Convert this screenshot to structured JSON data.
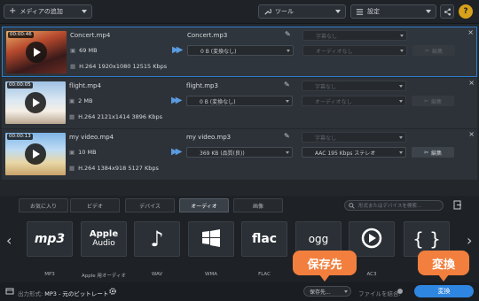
{
  "toolbar": {
    "add_media_label": "メディアの追加",
    "tools_label": "ツール",
    "settings_label": "設定"
  },
  "files": [
    {
      "duration": "00:00:46",
      "name": "Concert.mp4",
      "size": "69 MB",
      "info": "H.264 1920x1080 12515 Kbps",
      "output_name": "Concert.mp3",
      "output_size": "0 B (変換なし)",
      "subtitles": "字幕なし",
      "audio": "オーディオなし",
      "edit_label": "編集",
      "selected": true,
      "edit_enabled": false
    },
    {
      "duration": "00:00:05",
      "name": "flight.mp4",
      "size": "2 MB",
      "info": "H.264 2121x1414 3896 Kbps",
      "output_name": "flight.mp3",
      "output_size": "0 B (変換なし)",
      "subtitles": "字幕なし",
      "audio": "オーディオなし",
      "edit_label": "編集",
      "selected": false,
      "edit_enabled": false
    },
    {
      "duration": "00:00:13",
      "name": "my video.mp4",
      "size": "10 MB",
      "info": "H.264 1384x918 5127 Kbps",
      "output_name": "my video.mp3",
      "output_size": "369 KB (品質(良))",
      "subtitles": "字幕なし",
      "audio": "AAC 195 Kbps ステレオ",
      "edit_label": "編集",
      "selected": false,
      "edit_enabled": true
    }
  ],
  "tabs": [
    "お気に入り",
    "ビデオ",
    "デバイス",
    "オーディオ",
    "画像"
  ],
  "active_tab": "オーディオ",
  "search_placeholder": "形式またはデバイスを検索...",
  "formats": [
    {
      "name": "MP3",
      "logo": "mp3"
    },
    {
      "name": "Apple 用オーディオ",
      "logo": "Apple Audio"
    },
    {
      "name": "WAV",
      "logo": "note-icon"
    },
    {
      "name": "WMA",
      "logo": "windows-icon"
    },
    {
      "name": "FLAC",
      "logo": "flac"
    },
    {
      "name": "OGG",
      "logo": "ogg"
    },
    {
      "name": "AC3",
      "logo": "ac3-icon"
    },
    {
      "name": "",
      "logo": "braces-icon"
    }
  ],
  "footer": {
    "output_format_label": "出力形式:",
    "output_format_value": "MP3 - 元のビットレート",
    "save_to_label": "保存先...",
    "merge_label": "ファイルを結合:",
    "convert_label": "変換"
  },
  "callouts": {
    "save_to": "保存先",
    "convert": "変換"
  },
  "colors": {
    "accent": "#2f7fd0",
    "callout": "#f27f3d",
    "convert_button": "#2f86e0"
  }
}
